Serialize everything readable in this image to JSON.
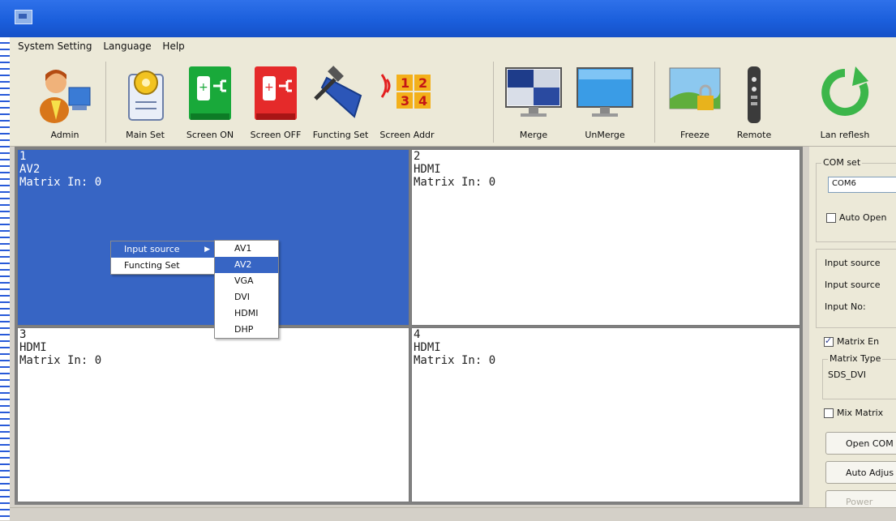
{
  "menubar": {
    "system_setting": "System Setting",
    "language": "Language",
    "help": "Help"
  },
  "toolbar": {
    "admin": "Admin",
    "main_set": "Main Set",
    "screen_on": "Screen ON",
    "screen_off": "Screen OFF",
    "functing_set": "Functing Set",
    "screen_addr": "Screen Addr",
    "merge": "Merge",
    "unmerge": "UnMerge",
    "freeze": "Freeze",
    "remote": "Remote",
    "lan_refresh": "Lan reflesh"
  },
  "screens": [
    {
      "num": "1",
      "source": "AV2",
      "matrix": "Matrix In: 0"
    },
    {
      "num": "2",
      "source": "HDMI",
      "matrix": "Matrix In: 0"
    },
    {
      "num": "3",
      "source": "HDMI",
      "matrix": "Matrix In: 0"
    },
    {
      "num": "4",
      "source": "HDMI",
      "matrix": "Matrix In: 0"
    }
  ],
  "context_menu": {
    "input_source": "Input source",
    "functing_set": "Functing Set"
  },
  "submenu": [
    "AV1",
    "AV2",
    "VGA",
    "DVI",
    "HDMI",
    "DHP"
  ],
  "side": {
    "com_group": "COM set",
    "com_value": "COM6",
    "auto_open": "Auto Open",
    "input_source_1": "Input source",
    "input_source_2": "Input source",
    "input_no": "Input No:",
    "matrix_enable": "Matrix En",
    "matrix_type_label": "Matrix Type",
    "matrix_type_value": "SDS_DVI",
    "mix_matrix": "Mix Matrix",
    "open_com": "Open COM",
    "auto_adjust": "Auto Adjus",
    "power": "Power"
  },
  "colors": {
    "selected": "#3765c4",
    "titlebar": "#1b5fdc"
  }
}
